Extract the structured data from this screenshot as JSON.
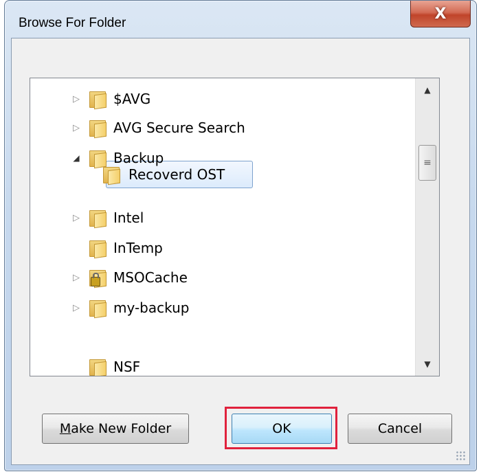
{
  "window": {
    "title": "Browse For Folder",
    "close_label": "X"
  },
  "tree": {
    "items": [
      {
        "label": "$AVG",
        "expander": "▷",
        "expanded": false,
        "selected": false,
        "locked": false
      },
      {
        "label": "AVG Secure Search",
        "expander": "▷",
        "expanded": false,
        "selected": false,
        "locked": false
      },
      {
        "label": "Backup",
        "expander": "◢",
        "expanded": true,
        "selected": false,
        "locked": false
      },
      {
        "label": "Recoverd OST",
        "expander": "",
        "expanded": false,
        "selected": true,
        "locked": false
      },
      {
        "label": "Intel",
        "expander": "▷",
        "expanded": false,
        "selected": false,
        "locked": false
      },
      {
        "label": "InTemp",
        "expander": "",
        "expanded": false,
        "selected": false,
        "locked": false
      },
      {
        "label": "MSOCache",
        "expander": "▷",
        "expanded": false,
        "selected": false,
        "locked": true
      },
      {
        "label": "my-backup",
        "expander": "▷",
        "expanded": false,
        "selected": false,
        "locked": false
      },
      {
        "label": "NSF",
        "expander": "",
        "expanded": false,
        "selected": false,
        "locked": false
      }
    ],
    "scroll_up": "▲",
    "scroll_down": "▼",
    "thumb_grip": "≡"
  },
  "buttons": {
    "make_new_folder_mnemonic": "M",
    "make_new_folder_rest": "ake New Folder",
    "ok": "OK",
    "cancel": "Cancel"
  },
  "colors": {
    "highlight": "#e0213c",
    "selection_border": "#7da2ce"
  }
}
